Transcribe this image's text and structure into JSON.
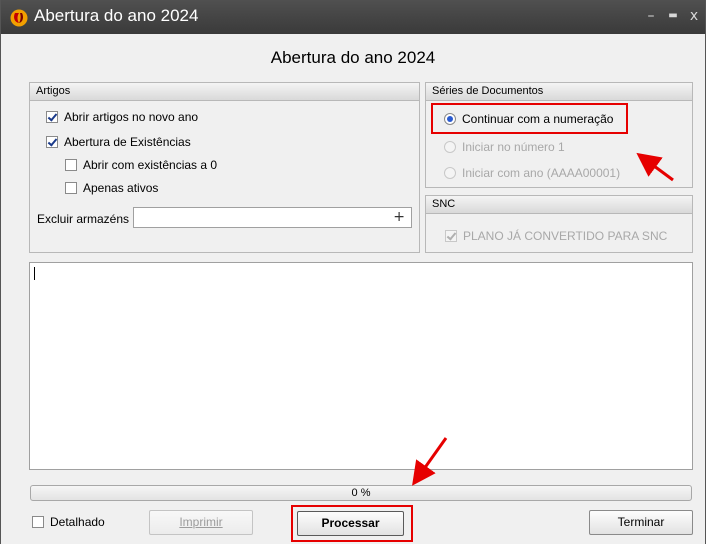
{
  "window": {
    "title": "Abertura do ano 2024"
  },
  "header": {
    "title": "Abertura do ano 2024"
  },
  "artigos": {
    "legend": "Artigos",
    "abrir_artigos": "Abrir artigos no novo ano",
    "abertura_existencias": "Abertura  de Existências",
    "abrir_zero": "Abrir com existências a 0",
    "apenas_ativos": "Apenas ativos",
    "excluir_label": "Excluir armazéns",
    "excluir_value": "",
    "add_glyph": "+"
  },
  "series": {
    "legend": "Séries de Documentos",
    "opt_continuar": "Continuar com a numeração",
    "opt_iniciar_numero": "Iniciar no número 1",
    "opt_iniciar_ano": "Iniciar com ano (AAAA00001)"
  },
  "snc": {
    "legend": "SNC",
    "plano": "PLANO JÁ CONVERTIDO PARA SNC"
  },
  "log": {
    "text": ""
  },
  "progress": {
    "label": "0 %",
    "value": 0
  },
  "footer": {
    "detalhado": "Detalhado",
    "imprimir": "Imprimir",
    "processar": "Processar",
    "terminar": "Terminar"
  },
  "titlebar": {
    "min": "–",
    "max": "▬",
    "close": "x"
  },
  "colors": {
    "annotation": "#e60000",
    "radio_selected": "#2a5bd0"
  }
}
